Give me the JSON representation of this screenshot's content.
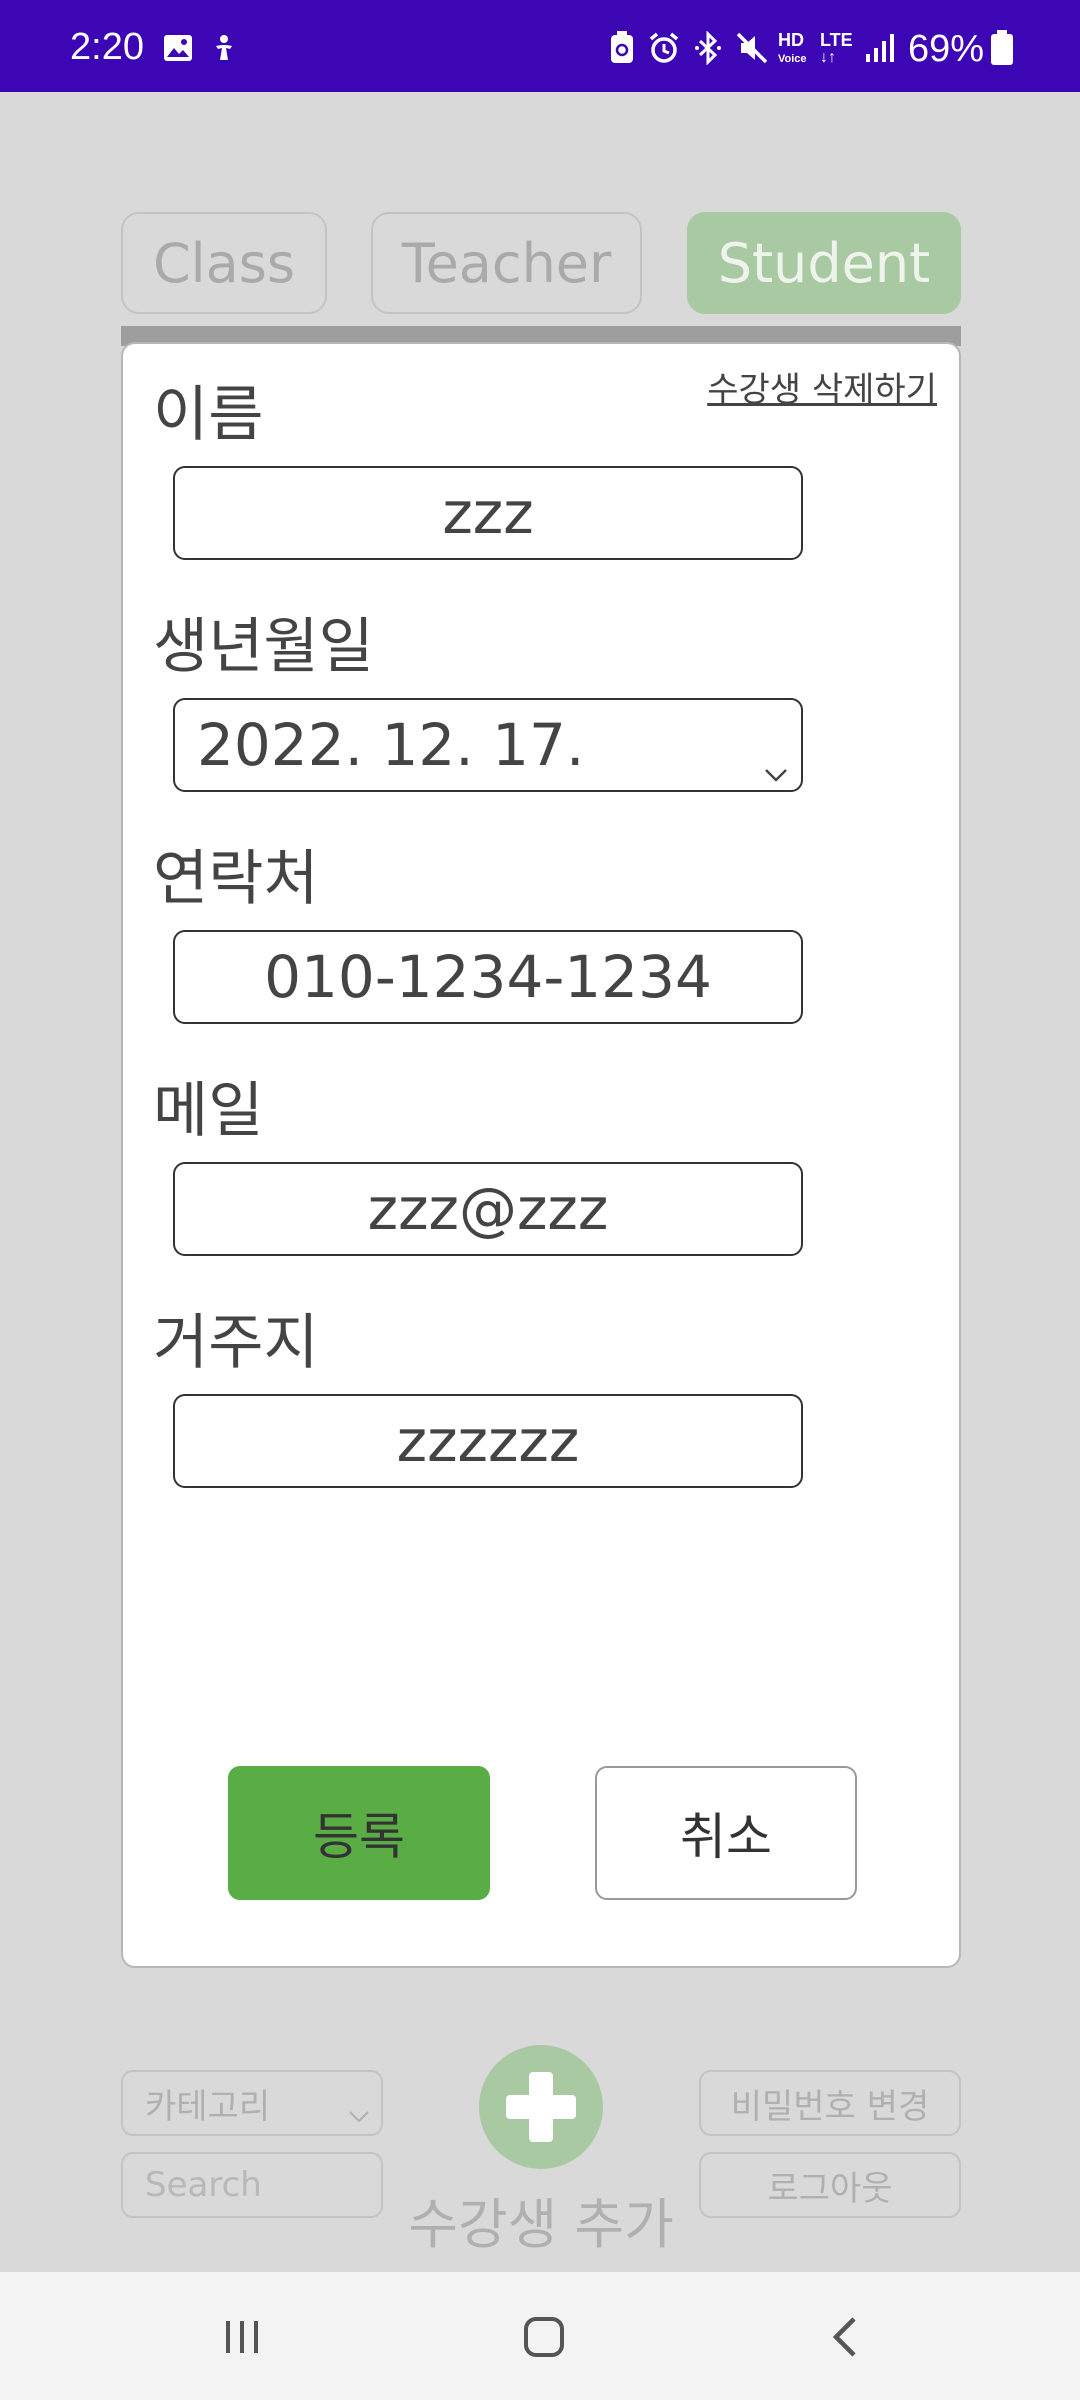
{
  "status_bar": {
    "time": "2:20",
    "battery_percent": "69%",
    "network_hd": "HD",
    "network_voice": "Voice",
    "network_lte": "LTE",
    "icons": [
      "image-icon",
      "accessibility-icon",
      "recycle-battery-icon",
      "alarm-icon",
      "bluetooth-icon",
      "mute-icon",
      "signal-icon",
      "battery-icon"
    ]
  },
  "tabs": [
    {
      "label": "Class"
    },
    {
      "label": "Teacher"
    },
    {
      "label": "Student"
    }
  ],
  "modal": {
    "delete_link": "수강생 삭제하기",
    "fields": {
      "name": {
        "label": "이름",
        "value": "zzz"
      },
      "birthdate": {
        "label": "생년월일",
        "value": "2022. 12. 17."
      },
      "phone": {
        "label": "연락처",
        "value": "010-1234-1234"
      },
      "email": {
        "label": "메일",
        "value": "zzz@zzz"
      },
      "address": {
        "label": "거주지",
        "value": "zzzzzz"
      }
    },
    "register_label": "등록",
    "cancel_label": "취소"
  },
  "bottom": {
    "category_select": "카테고리",
    "search_placeholder": "Search",
    "add_student_label": "수강생 추가",
    "change_password_label": "비밀번호 변경",
    "logout_label": "로그아웃"
  },
  "colors": {
    "status_bar": "#3d06b5",
    "accent_green": "#5aad45",
    "dim_green": "#a9c9a2",
    "overlay_bg": "#d9d9d9"
  }
}
